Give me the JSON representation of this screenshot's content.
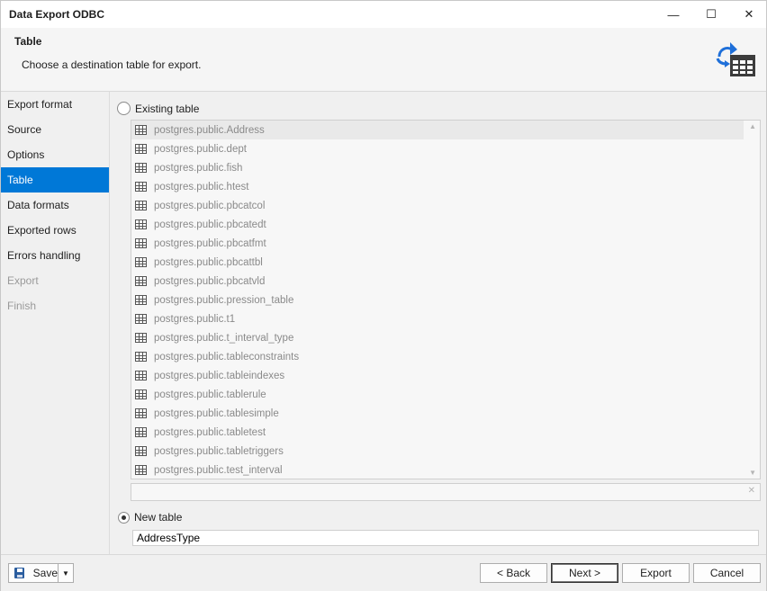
{
  "window": {
    "title": "Data Export ODBC",
    "minimize": "—",
    "maximize": "☐",
    "close": "✕"
  },
  "header": {
    "title": "Table",
    "subtitle": "Choose a destination table for export.",
    "icon": "export-table-icon"
  },
  "sidebar": {
    "items": [
      {
        "label": "Export format",
        "state": "normal"
      },
      {
        "label": "Source",
        "state": "normal"
      },
      {
        "label": "Options",
        "state": "normal"
      },
      {
        "label": "Table",
        "state": "active"
      },
      {
        "label": "Data formats",
        "state": "normal"
      },
      {
        "label": "Exported rows",
        "state": "normal"
      },
      {
        "label": "Errors handling",
        "state": "normal"
      },
      {
        "label": "Export",
        "state": "disabled"
      },
      {
        "label": "Finish",
        "state": "disabled"
      }
    ]
  },
  "existing": {
    "label": "Existing table",
    "checked": false,
    "tables": [
      "postgres.public.Address",
      "postgres.public.dept",
      "postgres.public.fish",
      "postgres.public.htest",
      "postgres.public.pbcatcol",
      "postgres.public.pbcatedt",
      "postgres.public.pbcatfmt",
      "postgres.public.pbcattbl",
      "postgres.public.pbcatvld",
      "postgres.public.pression_table",
      "postgres.public.t1",
      "postgres.public.t_interval_type",
      "postgres.public.tableconstraints",
      "postgres.public.tableindexes",
      "postgres.public.tablerule",
      "postgres.public.tablesimple",
      "postgres.public.tabletest",
      "postgres.public.tabletriggers",
      "postgres.public.test_interval"
    ],
    "filter_value": ""
  },
  "new_table": {
    "label": "New table",
    "checked": true,
    "value": "AddressType"
  },
  "footer": {
    "save": "Save",
    "back": "< Back",
    "next": "Next >",
    "export": "Export",
    "cancel": "Cancel"
  },
  "colors": {
    "accent": "#0078d7",
    "icon_blue": "#1e6fd9",
    "disabled_text": "#9a9a9a"
  }
}
